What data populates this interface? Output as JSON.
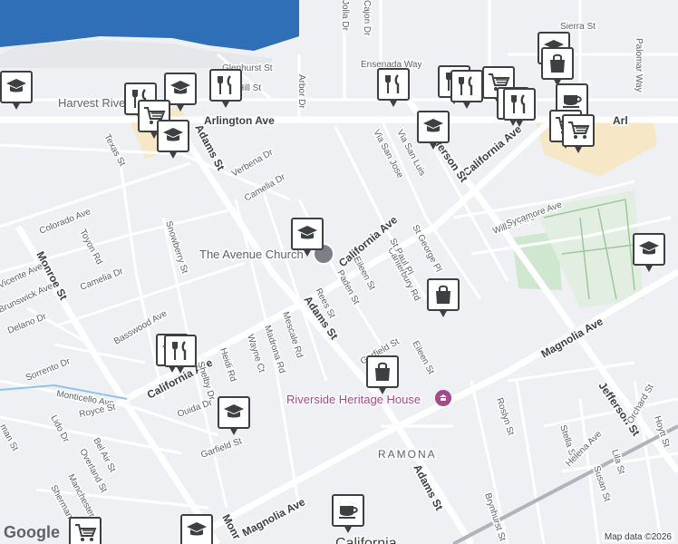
{
  "map": {
    "streets": {
      "arlington": "Arlington Ave",
      "arlington_right": "Arl",
      "california_main": "California Ave",
      "california_upper": "California Ave",
      "california_lower": "California Ave",
      "magnolia": "Magnolia Ave",
      "magnolia_lower": "Magnolia Ave",
      "adams": "Adams St",
      "adams_upper": "Adams St",
      "adams_lower": "Adams St",
      "jefferson_upper": "Jefferson St",
      "jefferson_lower": "Jefferson St",
      "monroe": "Monroe St",
      "monroe_lower": "Monr",
      "colorado": "Colorado Ave",
      "toyon": "Toyon Rd",
      "camelia_left": "Camelia Dr",
      "camelia_top": "Camelia Dr",
      "verbena": "Verbena Dr",
      "snowberry": "Snowberry St",
      "basswood": "Basswood Ave",
      "delano": "Delano Dr",
      "brunswick": "Brunswick Ave",
      "vicente": "Vicente Ave",
      "sorrento": "Sorrento Dr",
      "monticello": "Monticello Ave",
      "royce": "Royce St",
      "lido": "Lido Dr",
      "bel_air": "Bel Air St",
      "overland": "Overland St",
      "manchester": "Manchester Pl",
      "sherman": "Sherman Dr",
      "ouida": "Ouida Dr",
      "shelby": "Shelby Dr",
      "heidi": "Heidi Rd",
      "wayne": "Wayne Ct",
      "madrona": "Madrona Rd",
      "mescale": "Mescale Rd",
      "garfield_left": "Garfield St",
      "garfield_right": "Garfield St",
      "rees": "Rees St",
      "paden": "Paden St",
      "eileen_upper": "Eileen St",
      "eileen_lower": "Eileen St",
      "canterbury": "Canterbury Rd",
      "st_paul": "St Paul Pl",
      "st_george": "St George Pl",
      "via_san_jose": "Via San Jose",
      "via_san_luis": "Via San Luis",
      "willow": "Willow Ave",
      "sycamore": "Sycamore Ave",
      "texas": "Texas St",
      "glenhurst": "Glenhurst St",
      "hill": "Hill St",
      "arbor": "Arbor Dr",
      "jolla": "Jolla Dr",
      "cajon": "Cajon Dr",
      "ensenada": "Ensenada Way",
      "sierra": "Sierra St",
      "palomar": "Palomar Way",
      "roslyn": "Roslyn St",
      "brynhurst": "Brynhurst St",
      "stella": "Stella St",
      "helena": "Helena Ave",
      "lila": "Lila St",
      "susan": "Susan St",
      "orchard": "Orchard St",
      "hoytt": "Hoytt St",
      "manchester_left": "man St"
    },
    "places": {
      "harvest": "Harvest Rive",
      "church": "The Avenue Church",
      "heritage": "Riverside Heritage House",
      "ramona": "RAMONA",
      "california_city": "California"
    },
    "pins": [
      {
        "name": "school-pin",
        "icon": "school-icon"
      },
      {
        "name": "restaurant-pin",
        "icon": "restaurant-icon"
      },
      {
        "name": "shopping-pin",
        "icon": "cart-icon"
      },
      {
        "name": "store-pin",
        "icon": "bag-icon"
      },
      {
        "name": "cafe-pin",
        "icon": "coffee-icon"
      }
    ],
    "credit": "Map data ©2026",
    "logo": "Google",
    "colors": {
      "background": "#eef0f3",
      "water": "#2f6fb7",
      "road": "#ffffff",
      "poi": "#a34a87",
      "park": "#cfe6cf",
      "commercial": "#f6e7c6"
    }
  }
}
